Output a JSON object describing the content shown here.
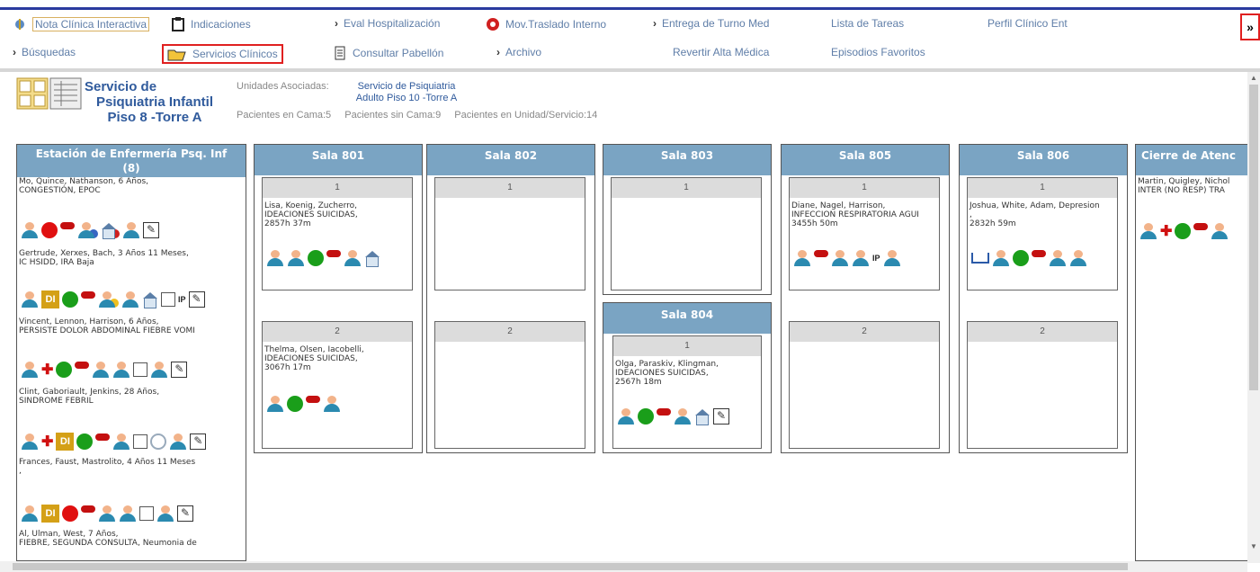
{
  "nav": {
    "row1": [
      {
        "label": "Nota Clínica Interactiva",
        "icon": "clinical-note-icon",
        "highlighted_soft": true
      },
      {
        "label": "Indicaciones",
        "icon": "clipboard-icon"
      },
      {
        "label": "Eval Hospitalización",
        "icon": "chevron-right-icon"
      },
      {
        "label": "Mov.Traslado Interno",
        "icon": "transfer-icon"
      },
      {
        "label": "Entrega de Turno Med",
        "icon": "chevron-right-icon"
      },
      {
        "label": "Lista de Tareas",
        "icon": ""
      },
      {
        "label": "Perfil Clínico Ent",
        "icon": ""
      }
    ],
    "row2": [
      {
        "label": "Búsquedas",
        "icon": "chevron-right-icon"
      },
      {
        "label": "Servicios Clínicos",
        "icon": "folder-open-icon",
        "highlighted": true
      },
      {
        "label": "Consultar Pabellón",
        "icon": "document-icon"
      },
      {
        "label": "Archivo",
        "icon": "chevron-right-icon"
      },
      {
        "label": "Revertir Alta Médica",
        "icon": ""
      },
      {
        "label": "Episodios Favoritos",
        "icon": ""
      }
    ],
    "collapse_glyph": "»"
  },
  "service": {
    "title_line1": "Servicio de",
    "title_line2": "Psiquiatria Infantil",
    "title_line3": "Piso 8 -Torre A",
    "units_label": "Unidades Asociadas:",
    "units_value_line1": "Servicio de Psiquiatria",
    "units_value_line2": "Adulto Piso 10 -Torre A",
    "count_in_bed": "Pacientes en Cama:5",
    "count_without_bed": "Pacientes sin Cama:9",
    "count_in_unit": "Pacientes en Unidad/Servicio:14"
  },
  "nursing_station": {
    "title_line1": "Estación de Enfermería Psq. Inf",
    "title_line2": "(8)",
    "patients": [
      {
        "line1": "Mo, Quince, Nathanson, 6 Años,",
        "line2": "CONGESTIÓN, EPOC"
      },
      {
        "line1": "Gertrude, Xerxes, Bach, 3 Años 11 Meses,",
        "line2": "IC HSIDD, IRA Baja"
      },
      {
        "line1": "Vincent, Lennon, Harrison, 6 Años,",
        "line2": "PERSISTE DOLOR ABDOMINAL FIEBRE VOMI"
      },
      {
        "line1": "Clint, Gaboriault, Jenkins, 28 Años,",
        "line2": "SINDROME FEBRIL"
      },
      {
        "line1": "Frances, Faust, Mastrolito, 4 Años 11 Meses",
        "line2": ","
      },
      {
        "line1": "Al, Ulman, West, 7 Años,",
        "line2": "FIEBRE, SEGUNDA CONSULTA, Neumonia de"
      }
    ]
  },
  "rooms": [
    {
      "name": "Sala 801",
      "bed1": {
        "num": "1",
        "l1": "Lisa, Koenig, Zucherro,",
        "l2": "IDEACIONES SUICIDAS,",
        "l3": "2857h 37m"
      },
      "bed2": {
        "num": "2",
        "l1": "Thelma, Olsen, Iacobelli,",
        "l2": "IDEACIONES SUICIDAS,",
        "l3": "3067h 17m"
      }
    },
    {
      "name": "Sala 802",
      "bed1": {
        "num": "1"
      },
      "bed2": {
        "num": "2"
      }
    },
    {
      "name": "Sala 803",
      "bed1": {
        "num": "1"
      }
    },
    {
      "name": "Sala 804",
      "bed1": {
        "num": "1",
        "l1": "Olga, Paraskiv, Klingman,",
        "l2": "IDEACIONES SUICIDAS,",
        "l3": "2567h 18m"
      }
    },
    {
      "name": "Sala 805",
      "bed1": {
        "num": "1",
        "l1": "Diane, Nagel, Harrison,",
        "l2": "INFECCION RESPIRATORIA AGUI",
        "l3": "3455h 50m"
      },
      "bed2": {
        "num": "2"
      }
    },
    {
      "name": "Sala 806",
      "bed1": {
        "num": "1",
        "l1": "Joshua, White, Adam, Depresion",
        "l2": ",",
        "l3": "2832h 59m"
      },
      "bed2": {
        "num": "2"
      }
    }
  ],
  "closing": {
    "title": "Cierre de Atenc",
    "line1": "Martin, Quigley, Nichol",
    "line2": "INTER (NO RESP) TRA"
  },
  "badge_text": {
    "di": "DI",
    "ip": "IP"
  }
}
